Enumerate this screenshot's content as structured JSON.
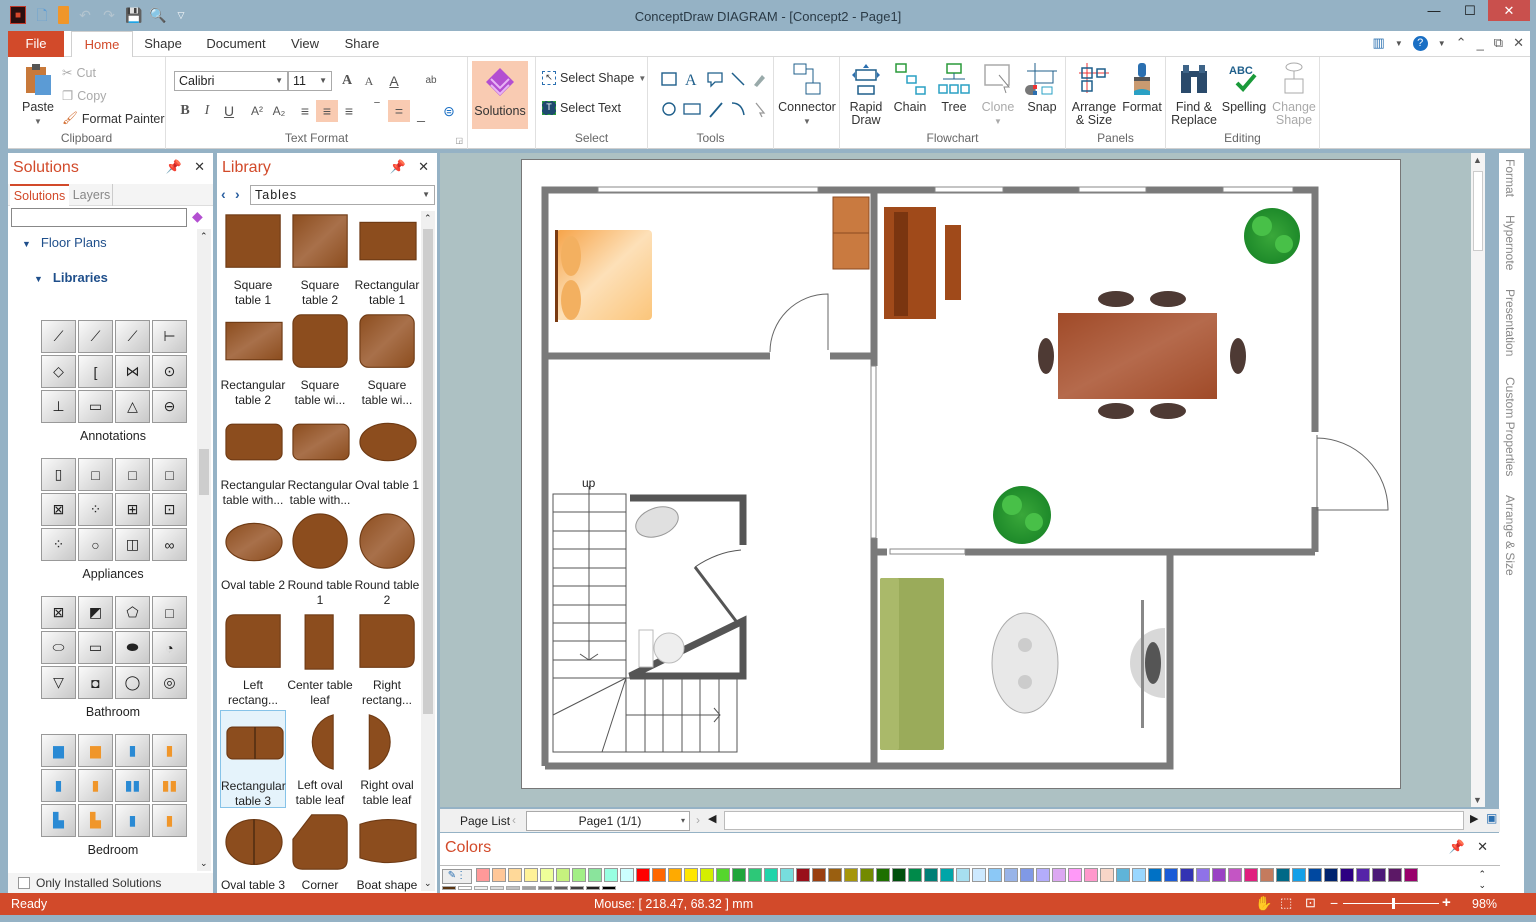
{
  "window": {
    "title": "ConceptDraw DIAGRAM - [Concept2 - Page1]",
    "controls": {
      "minimize": "—",
      "maximize": "☐",
      "close": "✕"
    }
  },
  "quick_access": [
    "app-logo-icon",
    "new-document-icon",
    "open-folder-icon",
    "undo-icon",
    "redo-icon",
    "save-icon",
    "print-preview-icon",
    "customize-dropdown-icon"
  ],
  "menu_tabs": [
    {
      "label": "File"
    },
    {
      "label": "Home",
      "active": true
    },
    {
      "label": "Shape"
    },
    {
      "label": "Document"
    },
    {
      "label": "View"
    },
    {
      "label": "Share"
    }
  ],
  "ribbon": {
    "clipboard": {
      "label": "Clipboard",
      "paste": "Paste",
      "cut": "Cut",
      "copy": "Copy",
      "format_painter": "Format Painter"
    },
    "text_format": {
      "label": "Text Format",
      "font": "Calibri",
      "size": "11"
    },
    "solutions": {
      "label": "Solutions"
    },
    "select": {
      "label": "Select",
      "select_shape": "Select Shape",
      "select_text": "Select Text"
    },
    "tools": {
      "label": "Tools"
    },
    "connector": {
      "label": "Connector"
    },
    "flowchart": {
      "label": "Flowchart",
      "rapid_draw": "Rapid Draw",
      "chain": "Chain",
      "tree": "Tree",
      "clone": "Clone",
      "snap": "Snap"
    },
    "panels": {
      "label": "Panels",
      "arrange": "Arrange & Size",
      "format": "Format"
    },
    "editing": {
      "label": "Editing",
      "find": "Find & Replace",
      "spelling": "Spelling",
      "change_shape": "Change Shape"
    }
  },
  "solutions_panel": {
    "title": "Solutions",
    "tabs": [
      "Solutions",
      "Layers"
    ],
    "search_value": "",
    "tree": {
      "floor_plans": "Floor Plans",
      "libraries": "Libraries"
    },
    "libraries": [
      {
        "name": "Annotations"
      },
      {
        "name": "Appliances"
      },
      {
        "name": "Bathroom"
      },
      {
        "name": "Bedroom"
      }
    ],
    "only_installed": "Only Installed Solutions",
    "only_installed_checked": false
  },
  "library_panel": {
    "title": "Library",
    "selected_library": "Tables",
    "items": [
      {
        "label": "Square table 1"
      },
      {
        "label": "Square table 2"
      },
      {
        "label": "Rectangular table 1"
      },
      {
        "label": "Rectangular table 2"
      },
      {
        "label": "Square table wi..."
      },
      {
        "label": "Square table wi..."
      },
      {
        "label": "Rectangular table with..."
      },
      {
        "label": "Rectangular table with..."
      },
      {
        "label": "Oval table 1"
      },
      {
        "label": "Oval table 2"
      },
      {
        "label": "Round table 1"
      },
      {
        "label": "Round table 2"
      },
      {
        "label": "Left rectang..."
      },
      {
        "label": "Center table leaf"
      },
      {
        "label": "Right rectang..."
      },
      {
        "label": "Rectangular table 3",
        "selected": true
      },
      {
        "label": "Left oval table leaf"
      },
      {
        "label": "Right oval table leaf"
      },
      {
        "label": "Oval table 3"
      },
      {
        "label": "Corner"
      },
      {
        "label": "Boat shape"
      }
    ]
  },
  "canvas": {
    "stairs_label": "up"
  },
  "right_tabs": [
    "Format",
    "Hypernote",
    "Presentation",
    "Custom Properties",
    "Arrange & Size"
  ],
  "page_bar": {
    "page_list": "Page List",
    "current_page": "Page1 (1/1)"
  },
  "colors_panel": {
    "title": "Colors",
    "swatches": [
      "#ff9999",
      "#ffc799",
      "#ffd999",
      "#fff299",
      "#eeff99",
      "#c6f27e",
      "#a2ef86",
      "#8ae49c",
      "#99ffe2",
      "#ccffff",
      "#ff0000",
      "#ff6600",
      "#ffaa00",
      "#ffe600",
      "#d4ef00",
      "#55d62d",
      "#1fa53a",
      "#2dc878",
      "#20d4aa",
      "#77dddd",
      "#990f1a",
      "#9a3f10",
      "#9a5f10",
      "#a6960a",
      "#738a00",
      "#1e7000",
      "#004f0d",
      "#008a4a",
      "#007f76",
      "#00a5a8",
      "#a7dff0",
      "#cde9ff",
      "#8bc8f6",
      "#99b4e8",
      "#8099e6",
      "#b3acfb",
      "#dca8f2",
      "#ff99f8",
      "#ff99cc",
      "#f8d6c8",
      "#5fb4d8",
      "#9ad7ff",
      "#0071c5",
      "#1b5bd6",
      "#3333b3",
      "#8f72e8",
      "#9a41c4",
      "#c455c4",
      "#e01f7e",
      "#c47b5e",
      "#006987",
      "#14a0e8",
      "#0048a0",
      "#00236e",
      "#2c0082",
      "#5524a8",
      "#4c1a78",
      "#5c1866",
      "#99006b"
    ],
    "grays": [
      "#5a3410",
      "#ffffff",
      "#f0f0f0",
      "#dcdcdc",
      "#c0c0c0",
      "#a0a0a0",
      "#808080",
      "#606060",
      "#404040",
      "#202020",
      "#000000"
    ]
  },
  "status_bar": {
    "ready": "Ready",
    "mouse": "Mouse: [ 218.47, 68.32 ] mm",
    "zoom": "98%",
    "zoom_level": 0.98
  }
}
